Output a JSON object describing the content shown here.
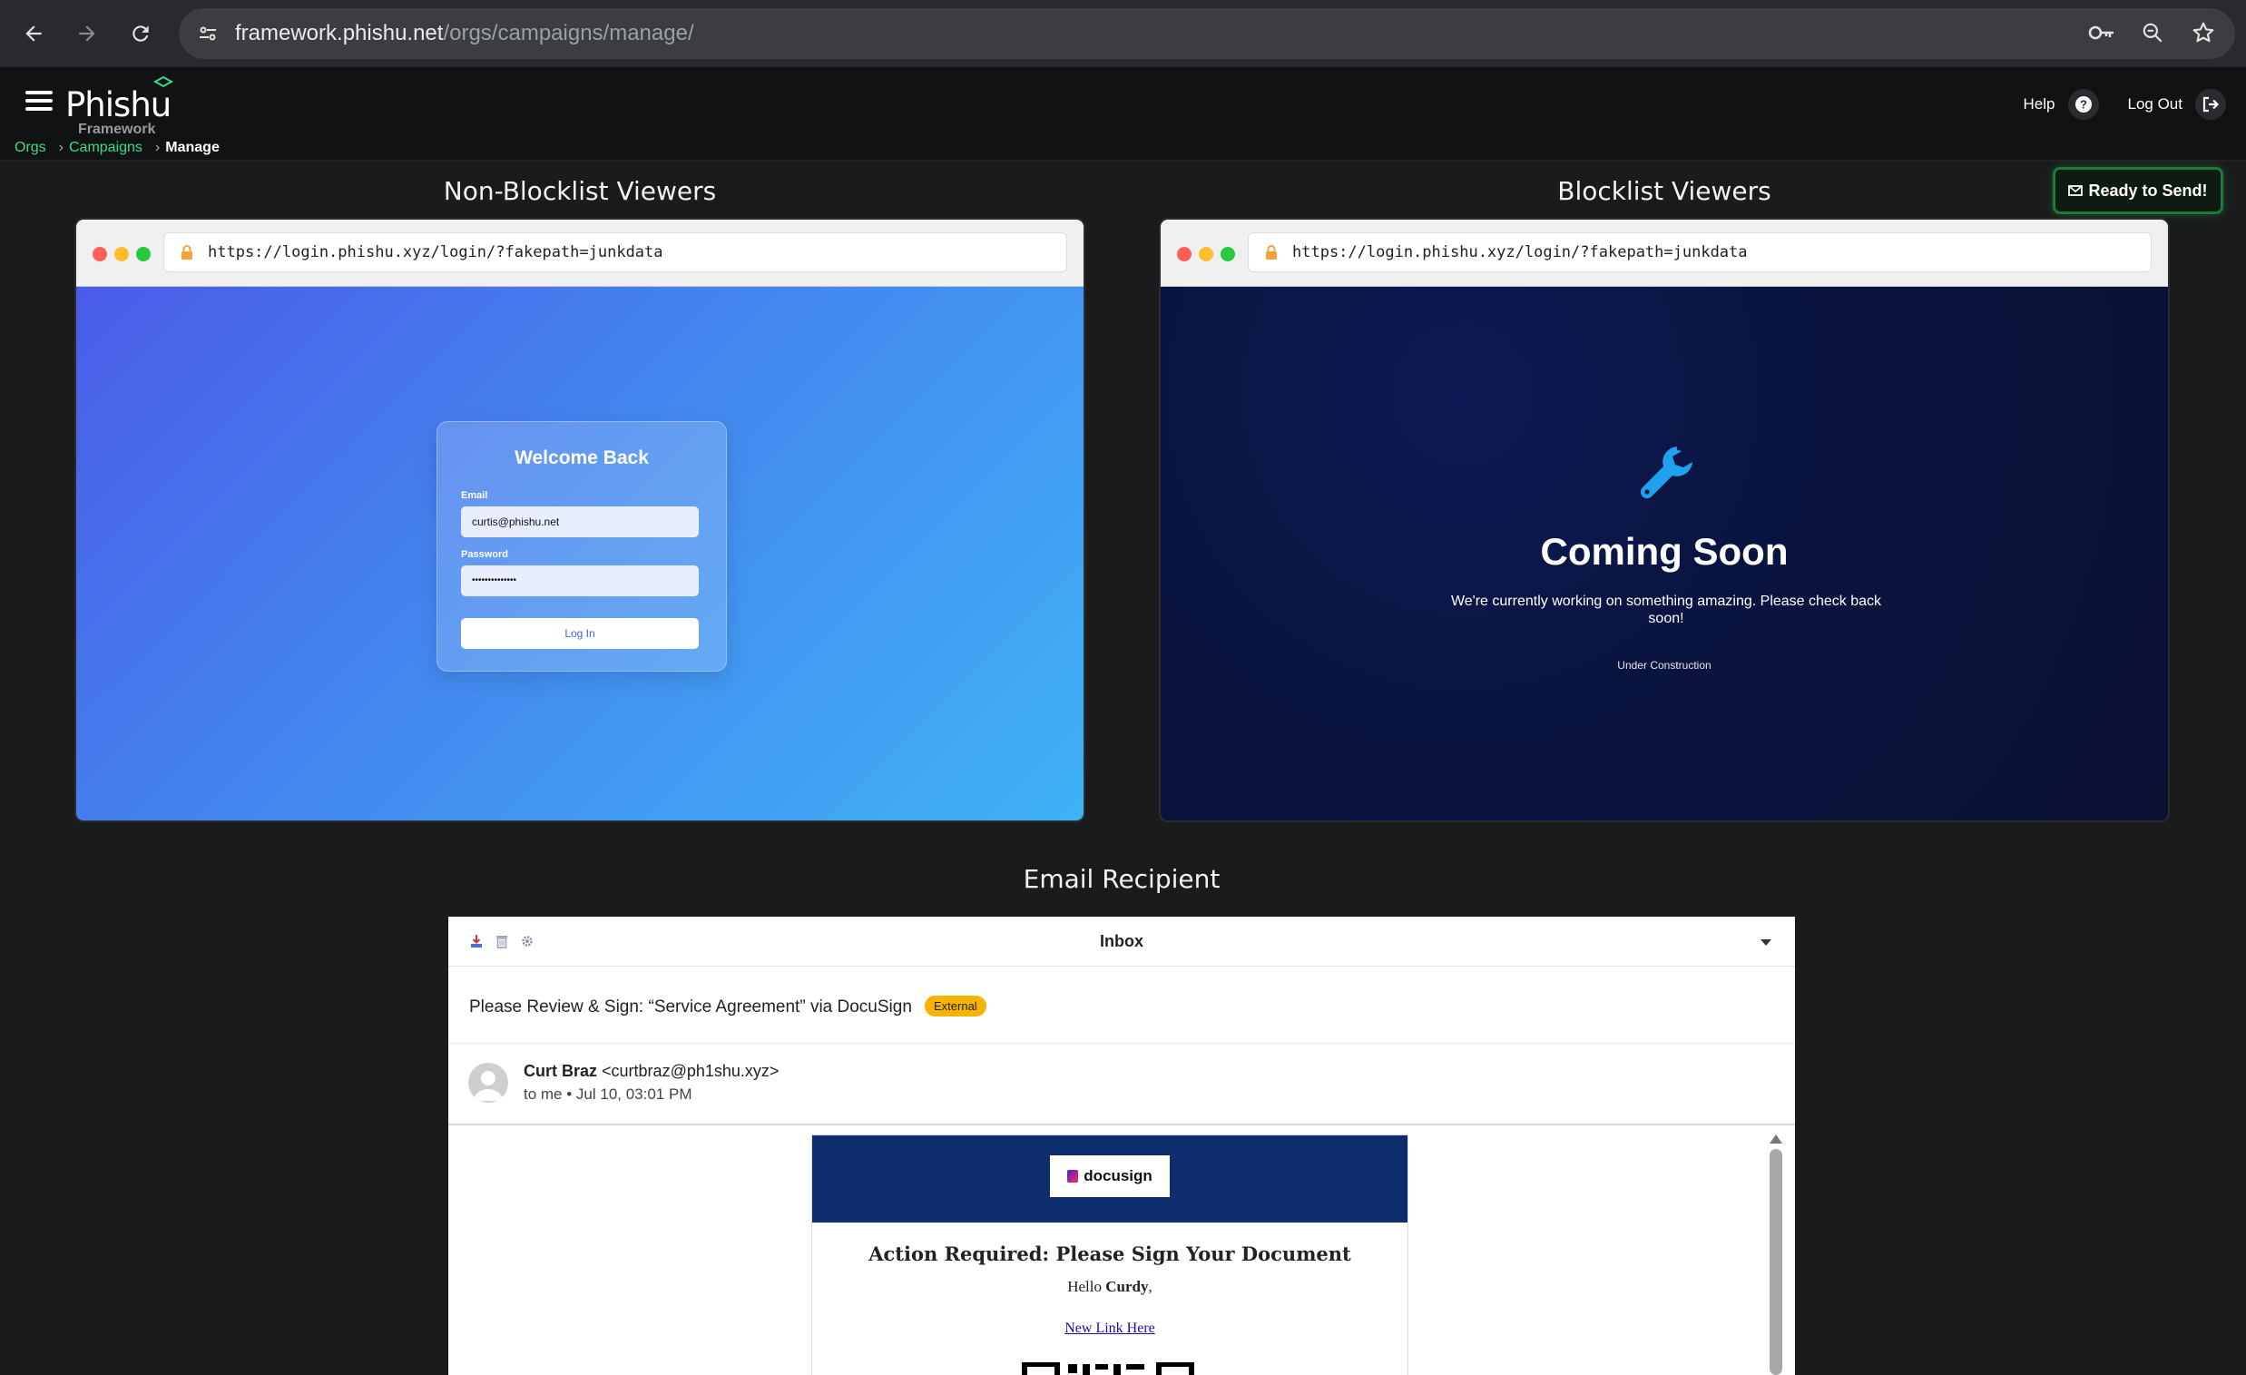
{
  "browser": {
    "url_host": "framework.phishu.net",
    "url_path": "/orgs/campaigns/manage/"
  },
  "app": {
    "logo_main": "Phishu",
    "logo_sub": "Framework",
    "breadcrumb": {
      "orgs": "Orgs",
      "campaigns": "Campaigns",
      "current": "Manage",
      "separator": "›"
    },
    "help_label": "Help",
    "logout_label": "Log Out",
    "ready_button": "Ready to Send!",
    "accent_color": "#3ddc84"
  },
  "sections": {
    "non_blocklist": "Non-Blocklist Viewers",
    "blocklist": "Blocklist Viewers",
    "email": "Email Recipient"
  },
  "non_blocklist_preview": {
    "url": "https://login.phishu.xyz/login/?fakepath=junkdata",
    "title": "Welcome Back",
    "email_label": "Email",
    "email_value": "curtis@phishu.net",
    "password_label": "Password",
    "password_value": "••••••••••••••",
    "login_button": "Log In"
  },
  "blocklist_preview": {
    "url": "https://login.phishu.xyz/login/?fakepath=junkdata",
    "icon": "wrench-icon",
    "title": "Coming Soon",
    "text": "We're currently working on something amazing. Please check back soon!",
    "small_text": "Under Construction"
  },
  "email_client": {
    "inbox_label": "Inbox",
    "subject": "Please Review & Sign: “Service Agreement” via DocuSign",
    "badge": "External",
    "sender_name": "Curt Braz",
    "sender_email": "<curtbraz@ph1shu.xyz>",
    "meta": "to me • Jul 10, 03:01 PM",
    "body": {
      "logo_text": "docusign",
      "title": "Action Required: Please Sign Your Document",
      "hello_prefix": "Hello ",
      "hello_name": "Curdy",
      "hello_suffix": ",",
      "link_text": "New Link Here"
    }
  }
}
